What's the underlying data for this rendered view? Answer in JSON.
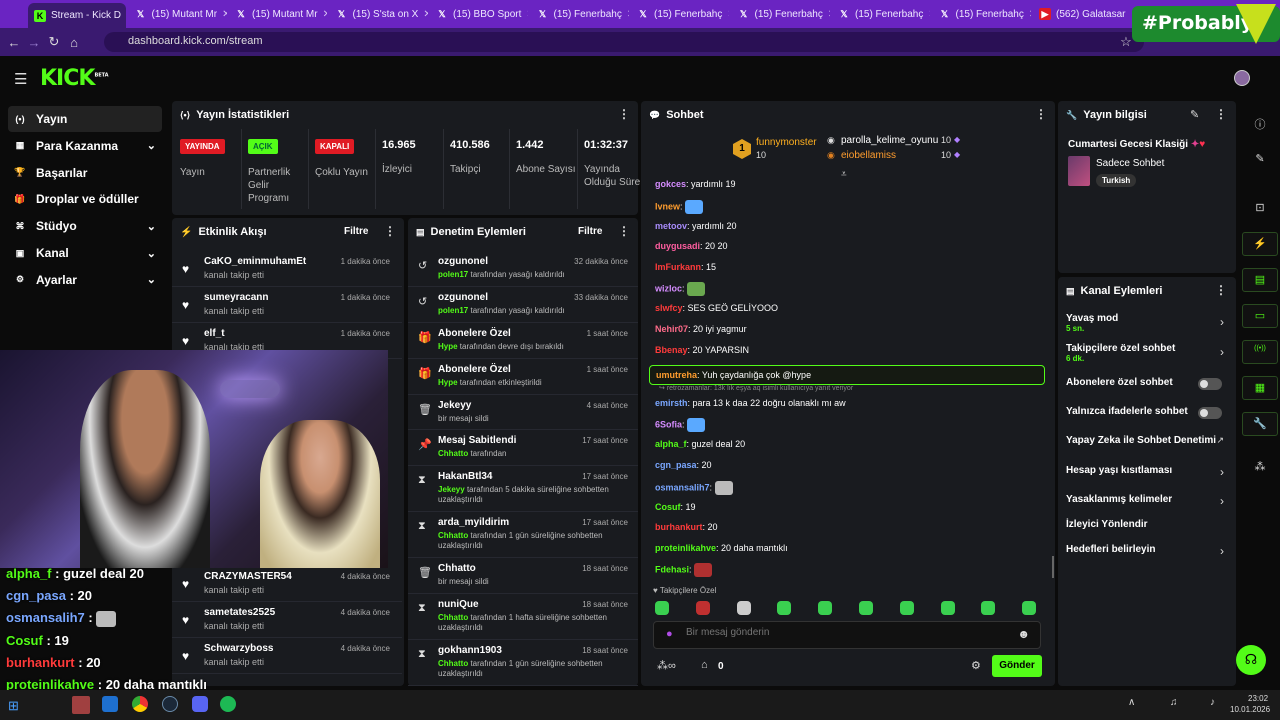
{
  "browser": {
    "tabs": [
      {
        "title": "Stream - Kick D",
        "icon": "kick-icon",
        "active": true
      },
      {
        "title": "(15) Mutant Mr",
        "icon": "x-icon"
      },
      {
        "title": "(15) Mutant Mr",
        "icon": "x-icon"
      },
      {
        "title": "(15) S'sta on X",
        "icon": "x-icon"
      },
      {
        "title": "(15) BBO Sport",
        "icon": "x-icon"
      },
      {
        "title": "(15) Fenerbahç",
        "icon": "x-icon"
      },
      {
        "title": "(15) Fenerbahç",
        "icon": "x-icon"
      },
      {
        "title": "(15) Fenerbahç",
        "icon": "x-icon"
      },
      {
        "title": "(15) Fenerbahç",
        "icon": "x-icon"
      },
      {
        "title": "(15) Fenerbahç",
        "icon": "x-icon"
      },
      {
        "title": "(562) Galatasar",
        "icon": "youtube-icon"
      }
    ],
    "url": "dashboard.kick.com/stream",
    "overlay_badge": "#Probably"
  },
  "app": {
    "logo": "KICK",
    "logo_sup": "BETA"
  },
  "sidebar": {
    "items": [
      {
        "label": "Yayın",
        "icon": "stream-icon",
        "active": true
      },
      {
        "label": "Para Kazanma",
        "icon": "money-icon",
        "chevron": true
      },
      {
        "label": "Başarılar",
        "icon": "trophy-icon"
      },
      {
        "label": "Droplar ve ödüller",
        "icon": "gift-icon"
      },
      {
        "label": "Stüdyo",
        "icon": "studio-icon",
        "chevron": true
      },
      {
        "label": "Kanal",
        "icon": "channel-icon",
        "chevron": true
      },
      {
        "label": "Ayarlar",
        "icon": "settings-icon",
        "chevron": true
      }
    ]
  },
  "stats": {
    "title": "Yayın İstatistikleri",
    "items": [
      {
        "badge": "YAYINDA",
        "label": "Yayın",
        "color": "#e01b24"
      },
      {
        "badge": "AÇIK",
        "label": "Partnerlik Gelir Programı",
        "color": "#53fc18"
      },
      {
        "badge": "KAPALI",
        "label": "Çoklu Yayın",
        "color": "#e01b24"
      },
      {
        "value": "16.965",
        "label": "İzleyici"
      },
      {
        "value": "410.586",
        "label": "Takipçi"
      },
      {
        "value": "1.442",
        "label": "Abone Sayısı"
      },
      {
        "value": "01:32:37",
        "label": "Yayında Olduğu Süre"
      }
    ]
  },
  "activity": {
    "title": "Etkinlik Akışı",
    "filter": "Filtre",
    "items": [
      {
        "name": "CaKO_eminmuhamEt",
        "action": "kanalı takip etti",
        "time": "1 dakika önce"
      },
      {
        "name": "sumeyracann",
        "action": "kanalı takip etti",
        "time": "1 dakika önce"
      },
      {
        "name": "elf_t",
        "action": "kanalı takip etti",
        "time": "1 dakika önce"
      },
      {
        "name": "CRAZYMASTER54",
        "action": "kanalı takip etti",
        "time": "4 dakika önce"
      },
      {
        "name": "sametates2525",
        "action": "kanalı takip etti",
        "time": "4 dakika önce"
      },
      {
        "name": "Schwarzyboss",
        "action": "kanalı takip etti",
        "time": "4 dakika önce"
      }
    ]
  },
  "moderation": {
    "title": "Denetim Eylemleri",
    "filter": "Filtre",
    "items": [
      {
        "name": "ozgunonel",
        "icon": "undo-icon",
        "actor": "polen17",
        "desc": "tarafından yasağı kaldırıldı",
        "time": "32 dakika önce"
      },
      {
        "name": "ozgunonel",
        "icon": "undo-icon",
        "actor": "polen17",
        "desc": "tarafından yasağı kaldırıldı",
        "time": "33 dakika önce"
      },
      {
        "name": "Abonelere Özel",
        "icon": "gift-icon",
        "actor": "Hype",
        "desc": "tarafından devre dışı bırakıldı",
        "time": "1 saat önce"
      },
      {
        "name": "Abonelere Özel",
        "icon": "gift-icon",
        "actor": "Hype",
        "desc": "tarafından etkinleştirildi",
        "time": "1 saat önce"
      },
      {
        "name": "Jekeyy",
        "icon": "trash-icon",
        "actor": "",
        "desc": "bir mesajı sildi",
        "time": "4 saat önce"
      },
      {
        "name": "Mesaj Sabitlendi",
        "icon": "pin-icon",
        "actor": "Chhatto",
        "desc": "tarafından",
        "time": "17 saat önce"
      },
      {
        "name": "HakanBtl34",
        "icon": "hourglass-icon",
        "actor": "Jekeyy",
        "desc": "tarafından 5 dakika süreliğine sohbetten uzaklaştırıldı",
        "time": "17 saat önce"
      },
      {
        "name": "arda_myildirim",
        "icon": "hourglass-icon",
        "actor": "Chhatto",
        "desc": "tarafından 1 gün süreliğine sohbetten uzaklaştırıldı",
        "time": "17 saat önce"
      },
      {
        "name": "Chhatto",
        "icon": "trash-icon",
        "actor": "",
        "desc": "bir mesajı sildi",
        "time": "18 saat önce"
      },
      {
        "name": "nuniQue",
        "icon": "hourglass-icon",
        "actor": "Chhatto",
        "desc": "tarafından 1 hafta süreliğine sohbetten uzaklaştırıldı",
        "time": "18 saat önce"
      },
      {
        "name": "gokhann1903",
        "icon": "hourglass-icon",
        "actor": "Chhatto",
        "desc": "tarafından 1 gün süreliğine sohbetten uzaklaştırıldı",
        "time": "18 saat önce"
      }
    ]
  },
  "chat": {
    "title": "Sohbet",
    "leaderboard": [
      {
        "rank": "1",
        "name": "funnymonster",
        "count": "10"
      },
      {
        "name": "parolla_kelime_oyunu",
        "count": "10"
      },
      {
        "name": "eiobellamiss",
        "count": "10"
      }
    ],
    "messages": [
      {
        "user": "gokces",
        "color": "#d58cff",
        "text": "yardımlı 19"
      },
      {
        "user": "lvnew",
        "color": "#ff9d2e",
        "text": "",
        "emote": "#5aa9ff"
      },
      {
        "user": "metoov",
        "color": "#a78bfa",
        "text": "yardımlı 20"
      },
      {
        "user": "duygusadi",
        "color": "#ff5ea0",
        "text": "20 20"
      },
      {
        "user": "ImFurkann",
        "color": "#ff3b3b",
        "text": "15"
      },
      {
        "user": "wizloc",
        "color": "#d58cff",
        "text": "",
        "emote": "#6aa84f"
      },
      {
        "user": "slwfcy",
        "color": "#ff3b3b",
        "text": "SES GEÖ GELİYOOO"
      },
      {
        "user": "Nehir07",
        "color": "#ff6b8a",
        "text": "20 iyi yagmur"
      },
      {
        "user": "Bbenay",
        "color": "#ff3b3b",
        "text": "20 YAPARSIN"
      },
      {
        "user": "umutreha",
        "color": "#ff9d2e",
        "text": "Yuh çaydanlığa çok @hype",
        "highlight": true
      },
      {
        "user": "emirsth",
        "color": "#7aa7ff",
        "text": "para 13 k daa 22 doğru olanaklı mı aw",
        "reply": "retrozamanlar: 13k lık eşya aq isimli kullanıcıya yanıt veriyor"
      },
      {
        "user": "6Sofia",
        "color": "#d58cff",
        "text": "",
        "emote": "#5aa9ff"
      },
      {
        "user": "alpha_f",
        "color": "#53fc18",
        "text": "guzel deal 20"
      },
      {
        "user": "cgn_pasa",
        "color": "#7aa7ff",
        "text": "20"
      },
      {
        "user": "osmansalih7",
        "color": "#7aa7ff",
        "text": "",
        "emote": "#bbbbbb"
      },
      {
        "user": "Cosuf",
        "color": "#53fc18",
        "text": "19"
      },
      {
        "user": "burhankurt",
        "color": "#ff3b3b",
        "text": "20"
      },
      {
        "user": "proteinlikahve",
        "color": "#53fc18",
        "text": "20 daha mantıklı"
      },
      {
        "user": "Fdehasi",
        "color": "#53fc18",
        "text": "",
        "emote": "#b03030"
      }
    ],
    "mode_label": "Takipçilere Özel",
    "input_placeholder": "Bir mesaj gönderin",
    "count": "0",
    "send_label": "Gönder"
  },
  "stream_info": {
    "title": "Yayın bilgisi",
    "stream_title": "Cumartesi Gecesi Klasiği",
    "category": "Sadece Sohbet",
    "tag": "Turkish"
  },
  "channel_actions": {
    "title": "Kanal Eylemleri",
    "items": [
      {
        "label": "Yavaş mod",
        "sub": "5 sn.",
        "type": "chevron"
      },
      {
        "label": "Takipçilere özel sohbet",
        "sub": "6 dk.",
        "type": "chevron"
      },
      {
        "label": "Abonelere özel sohbet",
        "type": "toggle"
      },
      {
        "label": "Yalnızca ifadelerle sohbet",
        "type": "toggle"
      },
      {
        "label": "Yapay Zeka ile Sohbet Denetimi",
        "type": "external"
      },
      {
        "label": "Hesap yaşı kısıtlaması",
        "type": "chevron"
      },
      {
        "label": "Yasaklanmış kelimeler",
        "type": "chevron"
      },
      {
        "label": "İzleyici Yönlendir",
        "type": "none"
      },
      {
        "label": "Hedefleri belirleyin",
        "type": "chevron"
      }
    ]
  },
  "overlay_chat": [
    {
      "user": "alpha_f",
      "text": "guzel deal 20",
      "color": "#53fc18"
    },
    {
      "user": "cgn_pasa",
      "text": "20",
      "color": "#7aa7ff"
    },
    {
      "user": "osmansalih7",
      "text": "",
      "color": "#7aa7ff"
    },
    {
      "user": "Cosuf",
      "text": "19",
      "color": "#53fc18"
    },
    {
      "user": "burhankurt",
      "text": "20",
      "color": "#ff3b3b"
    },
    {
      "user": "proteinlikahve",
      "text": "20 daha mantıklı",
      "color": "#53fc18"
    },
    {
      "user": "Fdehasi",
      "text": "",
      "color": "#53fc18"
    }
  ],
  "taskbar": {
    "time": "23:02",
    "date": "10.01.2026"
  }
}
